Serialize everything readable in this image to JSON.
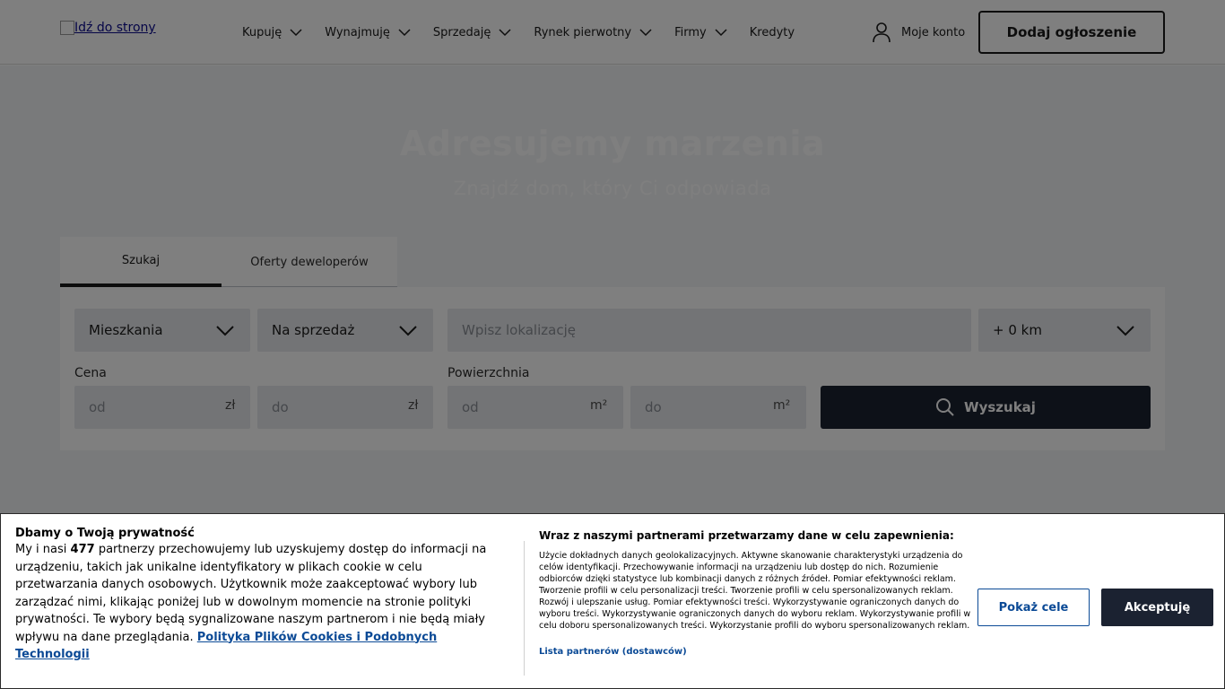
{
  "header": {
    "logo_alt": "Idź do strony",
    "nav": [
      {
        "label": "Kupuję",
        "has_dropdown": true
      },
      {
        "label": "Wynajmuję",
        "has_dropdown": true
      },
      {
        "label": "Sprzedaję",
        "has_dropdown": true
      },
      {
        "label": "Rynek pierwotny",
        "has_dropdown": true
      },
      {
        "label": "Firmy",
        "has_dropdown": true
      },
      {
        "label": "Kredyty",
        "has_dropdown": false
      }
    ],
    "account_label": "Moje konto",
    "add_listing_label": "Dodaj ogłoszenie"
  },
  "hero": {
    "title": "Adresujemy marzenia",
    "subtitle": "Znajdź dom, który Ci odpowiada"
  },
  "search": {
    "tabs": [
      "Szukaj",
      "Oferty deweloperów"
    ],
    "active_tab": "Szukaj",
    "property_type": "Mieszkania",
    "transaction_type": "Na sprzedaż",
    "location_placeholder": "Wpisz lokalizację",
    "radius": "+ 0 km",
    "price_label": "Cena",
    "price_from_placeholder": "od",
    "price_to_placeholder": "do",
    "price_unit": "zł",
    "area_label": "Powierzchnia",
    "area_from_placeholder": "od",
    "area_to_placeholder": "do",
    "area_unit": "m²",
    "search_button": "Wyszukaj"
  },
  "consent": {
    "title": "Dbamy o Twoją prywatność",
    "body_prefix": "My i nasi",
    "partner_count": "477",
    "body_suffix": "partnerzy przechowujemy lub uzyskujemy dostęp do informacji na urządzeniu, takich jak unikalne identyfikatory w plikach cookie w celu przetwarzania danych osobowych. Użytkownik może zaakceptować wybory lub zarządzać nimi, klikając poniżej lub w dowolnym momencie na stronie polityki prywatności. Te wybory będą sygnalizowane naszym partnerom i nie będą miały wpływu na dane przeglądania.",
    "policy_link": "Polityka Plików Cookies i Podobnych Technologii",
    "purposes_title": "Wraz z naszymi partnerami przetwarzamy dane w celu zapewnienia:",
    "purposes_text": "Użycie dokładnych danych geolokalizacyjnych. Aktywne skanowanie charakterystyki urządzenia do celów identyfikacji. Przechowywanie informacji na urządzeniu lub dostęp do nich. Rozumienie odbiorców dzięki statystyce lub kombinacji danych z różnych źródeł. Pomiar efektywności reklam. Tworzenie profili w celu personalizacji treści. Tworzenie profili w celu spersonalizowanych reklam. Rozwój i ulepszanie usług. Pomiar efektywności treści. Wykorzystywanie ograniczonych danych do wyboru treści. Wykorzystywanie ograniczonych danych do wyboru reklam. Wykorzystywanie profili w celu doboru spersonalizowanych treści. Wykorzystanie profili do wyboru spersonalizowanych reklam.",
    "partners_link": "Lista partnerów (dostawców)",
    "show_purposes_button": "Pokaż cele",
    "accept_button": "Akceptuję"
  }
}
